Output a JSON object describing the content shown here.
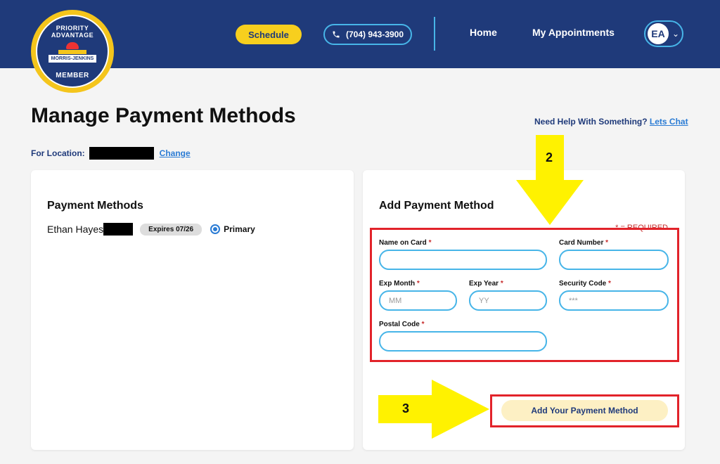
{
  "brand": {
    "top_text": "PRIORITY ADVANTAGE",
    "band_text": "MORRIS-JENKINS",
    "bottom_text": "MEMBER"
  },
  "header": {
    "schedule_label": "Schedule",
    "phone_label": "(704) 943-3900",
    "nav_home": "Home",
    "nav_appointments": "My Appointments",
    "user_initials": "EA"
  },
  "page": {
    "title": "Manage Payment Methods",
    "help_text": "Need Help With Something?",
    "help_link": "Lets Chat",
    "location_label": "For Location:",
    "change_link": "Change"
  },
  "payment_methods": {
    "heading": "Payment Methods",
    "items": [
      {
        "name": "Ethan Hayes",
        "expires": "Expires 07/26",
        "primary_label": "Primary"
      }
    ]
  },
  "add_form": {
    "heading": "Add Payment Method",
    "required_note": "* = REQUIRED",
    "fields": {
      "name_on_card": {
        "label": "Name on Card",
        "value": "",
        "placeholder": ""
      },
      "card_number": {
        "label": "Card Number",
        "value": "",
        "placeholder": ""
      },
      "exp_month": {
        "label": "Exp Month",
        "value": "",
        "placeholder": "MM"
      },
      "exp_year": {
        "label": "Exp Year",
        "value": "",
        "placeholder": "YY"
      },
      "security_code": {
        "label": "Security Code",
        "value": "",
        "placeholder": "***"
      },
      "postal_code": {
        "label": "Postal Code",
        "value": "",
        "placeholder": ""
      }
    },
    "submit_label": "Add Your Payment Method",
    "required_star": "*"
  },
  "annotations": {
    "step2": "2",
    "step3": "3"
  },
  "colors": {
    "header_bg": "#1f3a7a",
    "accent_yellow": "#f7cf1e",
    "accent_blue": "#47b5e8",
    "link_blue": "#2a7bd4",
    "annotation_red": "#e2232a",
    "annotation_arrow": "#fff200"
  }
}
